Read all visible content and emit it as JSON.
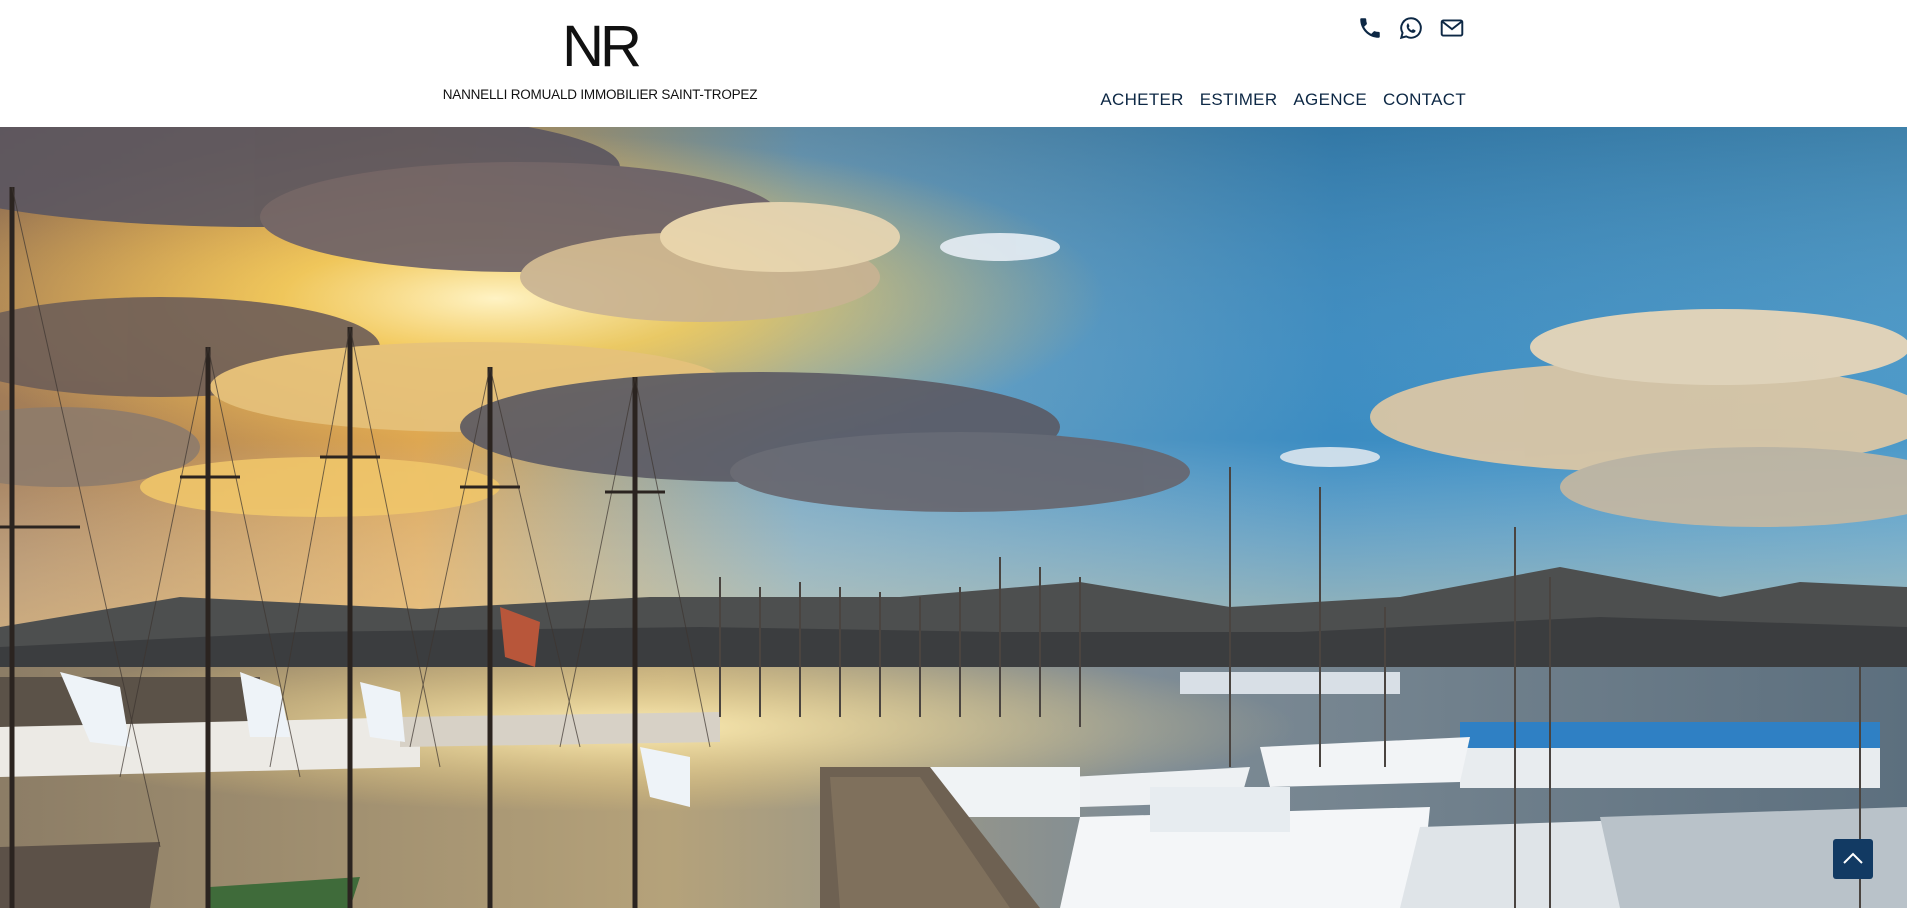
{
  "header": {
    "logo_mark": "NR",
    "logo_tagline": "NANNELLI ROMUALD IMMOBILIER SAINT-TROPEZ",
    "contact_icons": [
      "phone-icon",
      "whatsapp-icon",
      "mail-icon"
    ],
    "nav": {
      "acheter": "ACHETER",
      "estimer": "ESTIMER",
      "agence": "AGENCE",
      "contact": "CONTACT"
    }
  },
  "hero": {
    "image_subject": "Saint-Tropez harbor at sunset with sailboat masts and yachts"
  },
  "scroll_top": {
    "icon": "chevron-up-icon"
  },
  "colors": {
    "nav_text": "#0d2845",
    "scroll_button": "#123a63",
    "sky_blue": "#3f8fc4",
    "sunset_gold": "#f2c24a",
    "water": "#6f7d88"
  }
}
